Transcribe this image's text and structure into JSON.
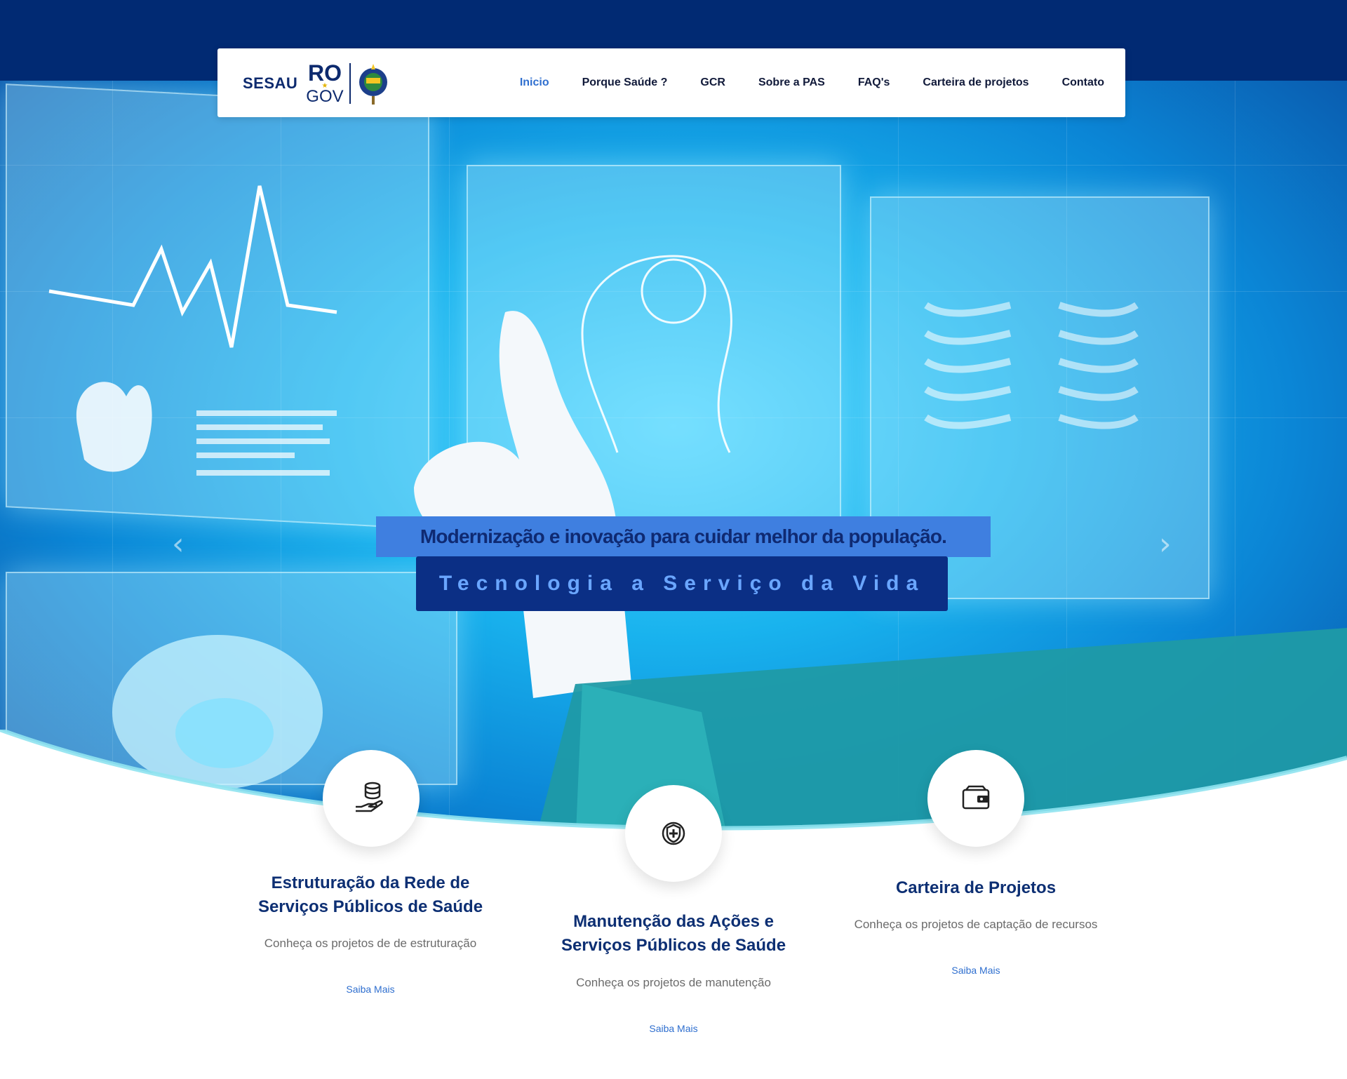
{
  "brand": {
    "sesau": "SESAU",
    "ro": "RO",
    "gov": "GOV"
  },
  "nav": {
    "items": [
      {
        "label": "Inicio",
        "active": true
      },
      {
        "label": "Porque Saúde ?"
      },
      {
        "label": "GCR"
      },
      {
        "label": "Sobre a PAS"
      },
      {
        "label": "FAQ's"
      },
      {
        "label": "Carteira de projetos"
      },
      {
        "label": "Contato"
      }
    ]
  },
  "hero": {
    "tagline": "Modernização e inovação para cuidar melhor da população.",
    "subtagline": "Tecnologia a Serviço da Vida",
    "prev_icon": "chevron-left-icon",
    "next_icon": "chevron-right-icon"
  },
  "cards": [
    {
      "icon": "coins-hand-icon",
      "title_line1": "Estruturação da Rede de",
      "title_line2": "Serviços Públicos de Saúde",
      "description": "Conheça os projetos de de estruturação",
      "link": "Saiba Mais"
    },
    {
      "icon": "health-shield-icon",
      "title_line1": "Manutenção das Ações e",
      "title_line2": "Serviços Públicos de Saúde",
      "description": "Conheça os projetos de manutenção",
      "link": "Saiba Mais"
    },
    {
      "icon": "wallet-icon",
      "title_line1": "Carteira de Projetos",
      "title_line2": "",
      "description": "Conheça os projetos de captação de recursos",
      "link": "Saiba Mais"
    }
  ],
  "colors": {
    "top_band": "#012a73",
    "accent": "#2f6fcf",
    "title": "#0d2f73"
  }
}
